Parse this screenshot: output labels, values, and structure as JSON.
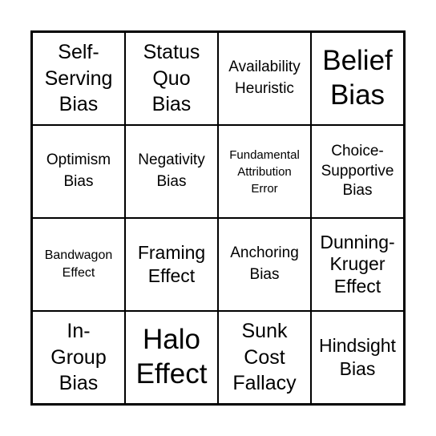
{
  "card": {
    "cells": [
      {
        "label": "Self-\nServing\nBias"
      },
      {
        "label": "Status\nQuo\nBias"
      },
      {
        "label": "Availability\nHeuristic"
      },
      {
        "label": "Belief\nBias"
      },
      {
        "label": "Optimism\nBias"
      },
      {
        "label": "Negativity\nBias"
      },
      {
        "label": "Fundamental\nAttribution\nError"
      },
      {
        "label": "Choice-\nSupportive\nBias"
      },
      {
        "label": "Bandwagon\nEffect"
      },
      {
        "label": "Framing\nEffect"
      },
      {
        "label": "Anchoring\nBias"
      },
      {
        "label": "Dunning-\nKruger\nEffect"
      },
      {
        "label": "In-\nGroup\nBias"
      },
      {
        "label": "Halo\nEffect"
      },
      {
        "label": "Sunk\nCost\nFallacy"
      },
      {
        "label": "Hindsight\nBias"
      }
    ]
  }
}
